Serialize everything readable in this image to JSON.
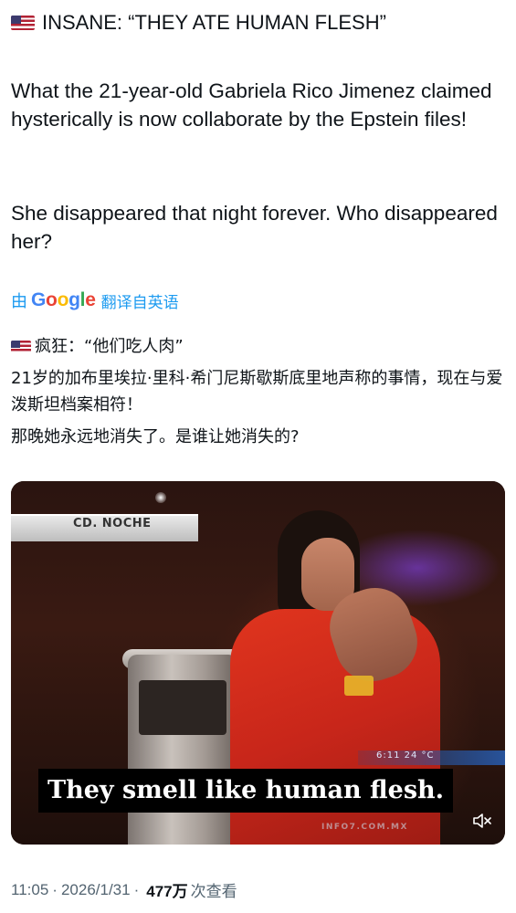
{
  "post": {
    "title": "INSANE: “THEY ATE HUMAN FLESH”",
    "paragraph1": "What the 21-year-old Gabriela Rico Jimenez claimed hysterically is now collaborate by the Epstein files!",
    "paragraph2": "She disappeared that night forever. Who disappeared her?"
  },
  "translation": {
    "by_label": "由",
    "brand": "Google",
    "from_label": "翻译自英语",
    "title": "疯狂：“他们吃人肉”",
    "paragraph1": "21岁的加布里埃拉·里科·希门尼斯歇斯底里地声称的事情，现在与爱泼斯坦档案相符！",
    "paragraph2": "那晚她永远地消失了。是谁让她消失的?"
  },
  "video": {
    "channel_label": "CD. NOCHE",
    "info_overlay": "6:11  24 °C",
    "watermark": "INFO7.COM.MX",
    "subtitle": "They smell like human flesh."
  },
  "meta": {
    "time": "11:05",
    "date": "2026/1/31",
    "separator": "·",
    "views": "477万",
    "views_label": "次查看"
  },
  "icons": {
    "flag": "us-flag-icon",
    "mute": "speaker-muted-icon"
  }
}
